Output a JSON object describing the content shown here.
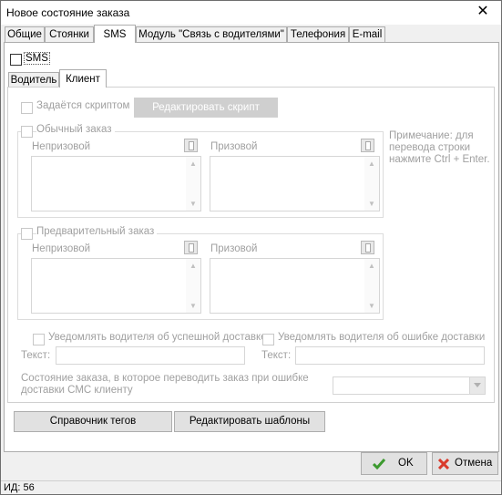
{
  "window": {
    "title": "Новое состояние заказа",
    "close_glyph": "✕"
  },
  "tabs": [
    "Общие",
    "Стоянки",
    "SMS",
    "Модуль \"Связь с водителями\"",
    "Телефония",
    "E-mail"
  ],
  "sms": {
    "enable_label": "SMS",
    "subtabs": [
      "Водитель",
      "Клиент"
    ],
    "client": {
      "script_label": "Задаётся скриптом",
      "edit_script_button": "Редактировать скрипт",
      "normal_order": {
        "label": "Обычный заказ",
        "non_prize": "Непризовой",
        "prize": "Призовой"
      },
      "preorder": {
        "label": "Предварительный заказ",
        "non_prize": "Непризовой",
        "prize": "Призовой"
      },
      "note": "Примечание: для перевода строки нажмите Ctrl + Enter.",
      "notify_success_label": "Уведомлять водителя об успешной доставке",
      "notify_error_label": "Уведомлять водителя об ошибке доставки",
      "text_label_left": "Текст:",
      "text_label_right": "Текст:",
      "text_value_left": "",
      "text_value_right": "",
      "state_on_error_label": "Состояние заказа, в которое переводить заказ при ошибке доставки СМС клиенту",
      "state_on_error_value": ""
    },
    "tags_button": "Справочник тегов",
    "templates_button": "Редактировать шаблоны"
  },
  "footer": {
    "ok_label": "OK",
    "cancel_label": "Отмена"
  },
  "status": {
    "id_text": "ИД: 56"
  },
  "colors": {
    "ok_check": "#3c9a2f",
    "cancel_x": "#d93a2b",
    "disabled_text": "#a0a0a0"
  }
}
